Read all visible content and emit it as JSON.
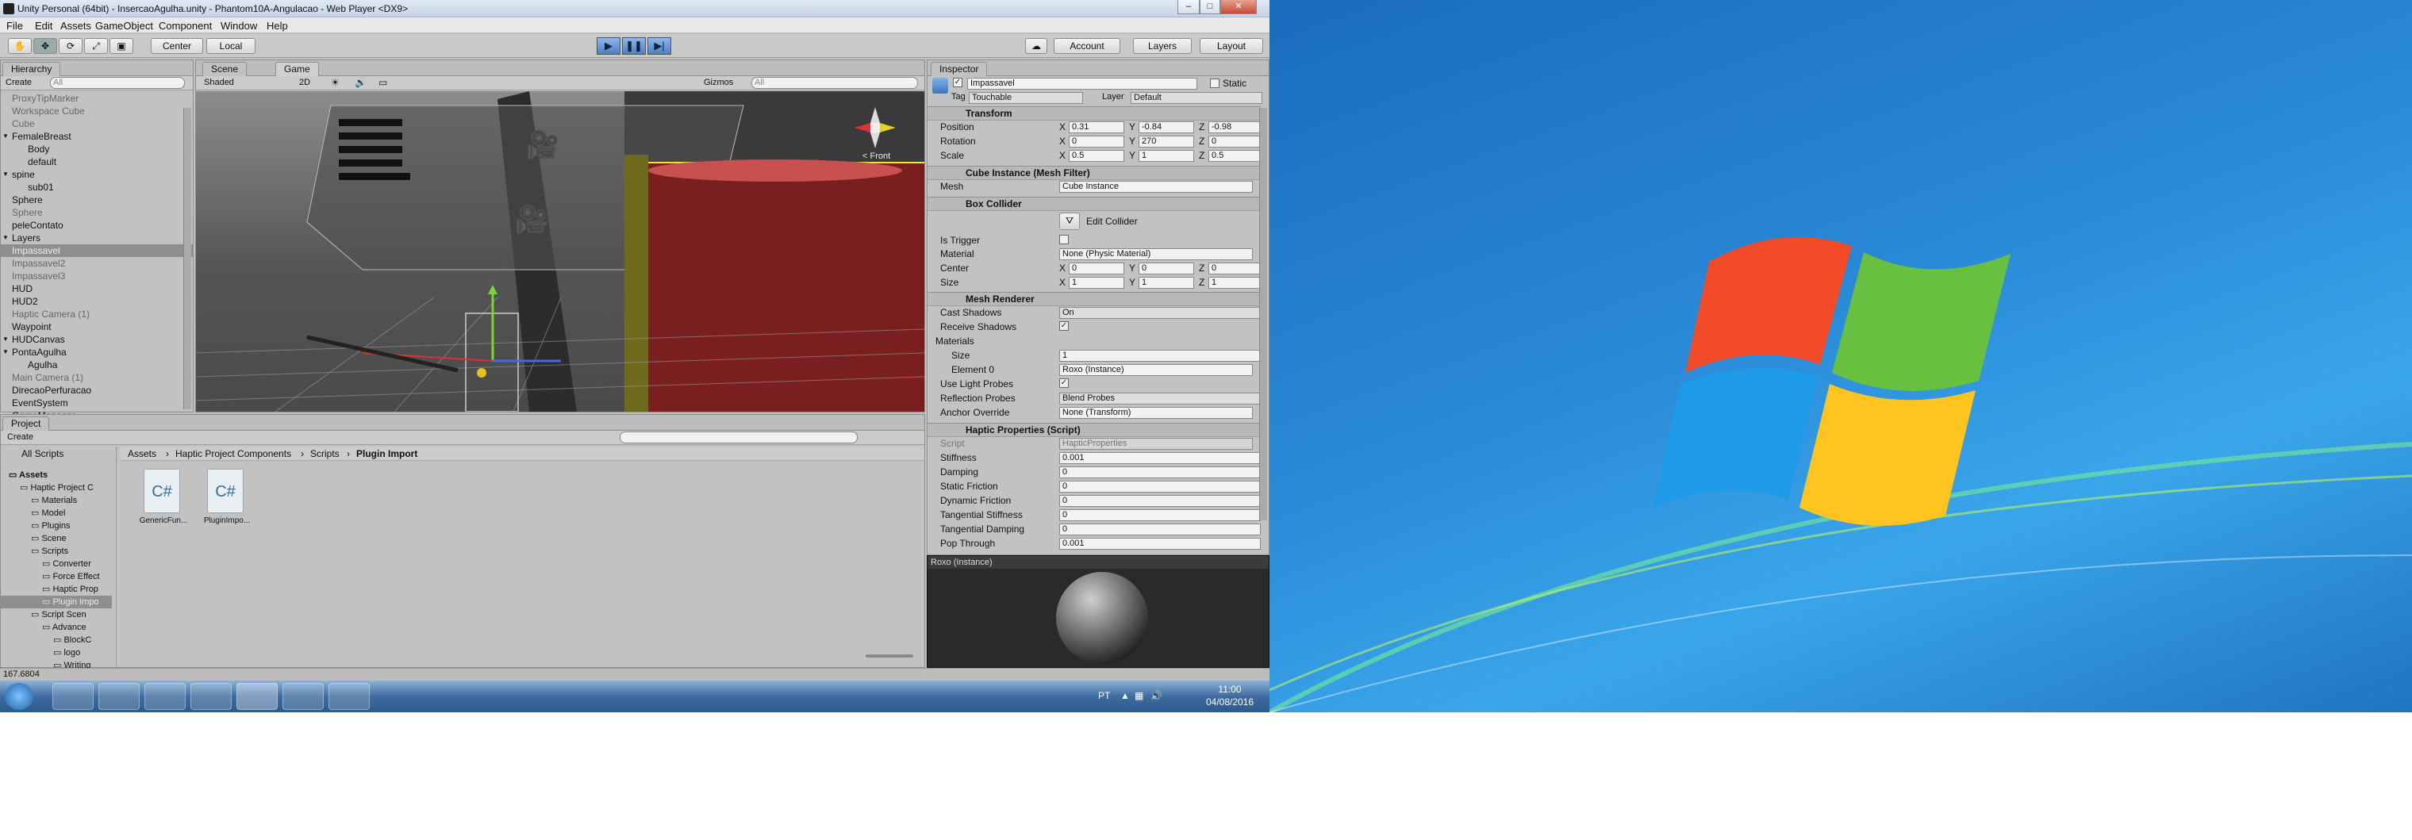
{
  "window": {
    "title": "Unity Personal (64bit) - InsercaoAgulha.unity - Phantom10A-Angulacao - Web Player <DX9>",
    "controls": [
      "–",
      "□",
      "✕"
    ]
  },
  "menu": [
    "File",
    "Edit",
    "Assets",
    "GameObject",
    "Component",
    "Window",
    "Help"
  ],
  "toolbar": {
    "pivot": "Center",
    "space": "Local",
    "account": "Account",
    "layers": "Layers",
    "layout": "Layout",
    "play": "▶",
    "pause": "❚❚",
    "step": "▶|"
  },
  "hierarchy": {
    "tab": "Hierarchy",
    "create": "Create",
    "search_placeholder": "All",
    "items": [
      {
        "label": "ProxyTipMarker",
        "dim": true,
        "indent": 0
      },
      {
        "label": "Workspace Cube",
        "dim": true,
        "indent": 0
      },
      {
        "label": "Cube",
        "dim": true,
        "indent": 0
      },
      {
        "label": "FemaleBreast",
        "dim": false,
        "indent": 0,
        "arrow": true
      },
      {
        "label": "Body",
        "dim": false,
        "indent": 1
      },
      {
        "label": "default",
        "dim": false,
        "indent": 1
      },
      {
        "label": "spine",
        "dim": false,
        "indent": 0,
        "arrow": true
      },
      {
        "label": "sub01",
        "dim": false,
        "indent": 1
      },
      {
        "label": "Sphere",
        "dim": false,
        "indent": 0
      },
      {
        "label": "Sphere",
        "dim": true,
        "indent": 0
      },
      {
        "label": "peleContato",
        "dim": false,
        "indent": 0
      },
      {
        "label": "Layers",
        "dim": false,
        "indent": 0,
        "arrow": true
      },
      {
        "label": "Impassavel",
        "dim": false,
        "indent": 0,
        "selected": true
      },
      {
        "label": "Impassavel2",
        "dim": true,
        "indent": 0
      },
      {
        "label": "Impassavel3",
        "dim": true,
        "indent": 0
      },
      {
        "label": "HUD",
        "dim": false,
        "indent": 0
      },
      {
        "label": "HUD2",
        "dim": false,
        "indent": 0
      },
      {
        "label": "Haptic Camera (1)",
        "dim": true,
        "indent": 0
      },
      {
        "label": "Waypoint",
        "dim": false,
        "indent": 0
      },
      {
        "label": "HUDCanvas",
        "dim": false,
        "indent": 0,
        "arrow": true
      },
      {
        "label": "PontaAgulha",
        "dim": false,
        "indent": 0,
        "arrow": true
      },
      {
        "label": "Agulha",
        "dim": false,
        "indent": 1
      },
      {
        "label": "Main Camera (1)",
        "dim": true,
        "indent": 0
      },
      {
        "label": "DirecaoPerfuracao",
        "dim": false,
        "indent": 0
      },
      {
        "label": "EventSystem",
        "dim": false,
        "indent": 0
      },
      {
        "label": "GameManager",
        "dim": false,
        "indent": 0
      }
    ]
  },
  "scene": {
    "tab_scene": "Scene",
    "tab_game": "Game",
    "shading": "Shaded",
    "mode2d": "2D",
    "gizmos": "Gizmos",
    "search_placeholder": "All",
    "gizmo_label": "< Front"
  },
  "inspector": {
    "tab": "Inspector",
    "name": "Impassavel",
    "static": "Static",
    "tag_label": "Tag",
    "tag": "Touchable",
    "layer_label": "Layer",
    "layer": "Default",
    "transform": {
      "title": "Transform",
      "position_label": "Position",
      "position": [
        "0.31",
        "-0.84",
        "-0.98"
      ],
      "rotation_label": "Rotation",
      "rotation": [
        "0",
        "270",
        "0"
      ],
      "scale_label": "Scale",
      "scale": [
        "0.5",
        "1",
        "0.5"
      ]
    },
    "mesh_filter": {
      "title": "Cube Instance (Mesh Filter)",
      "mesh_label": "Mesh",
      "mesh": "Cube Instance"
    },
    "box_collider": {
      "title": "Box Collider",
      "edit": "Edit Collider",
      "is_trigger_label": "Is Trigger",
      "material_label": "Material",
      "material": "None (Physic Material)",
      "center_label": "Center",
      "center": [
        "0",
        "0",
        "0"
      ],
      "size_label": "Size",
      "size": [
        "1",
        "1",
        "1"
      ]
    },
    "mesh_renderer": {
      "title": "Mesh Renderer",
      "cast_shadows_label": "Cast Shadows",
      "cast_shadows": "On",
      "receive_shadows_label": "Receive Shadows",
      "materials_label": "Materials",
      "size_label": "Size",
      "size": "1",
      "element0_label": "Element 0",
      "element0": "Roxo (Instance)",
      "light_probes_label": "Use Light Probes",
      "reflection_probes_label": "Reflection Probes",
      "reflection_probes": "Blend Probes",
      "anchor_override_label": "Anchor Override",
      "anchor_override": "None (Transform)"
    },
    "haptic": {
      "title": "Haptic Properties (Script)",
      "script_label": "Script",
      "script": "HapticProperties",
      "rows": [
        {
          "label": "Stiffness",
          "value": "0.001"
        },
        {
          "label": "Damping",
          "value": "0"
        },
        {
          "label": "Static Friction",
          "value": "0"
        },
        {
          "label": "Dynamic Friction",
          "value": "0"
        },
        {
          "label": "Tangential Stiffness",
          "value": "0"
        },
        {
          "label": "Tangential Damping",
          "value": "0"
        },
        {
          "label": "Pop Through",
          "value": "0.001"
        }
      ]
    },
    "preview_title": "Roxo (Instance)"
  },
  "project": {
    "tab": "Project",
    "create": "Create",
    "favorites": "All Scripts",
    "breadcrumb": [
      "Assets",
      "Haptic Project Components",
      "Scripts",
      "Plugin Import"
    ],
    "tree": [
      {
        "label": "Assets",
        "indent": 0,
        "bold": true
      },
      {
        "label": "Haptic Project C",
        "indent": 1
      },
      {
        "label": "Materials",
        "indent": 2
      },
      {
        "label": "Model",
        "indent": 2
      },
      {
        "label": "Plugins",
        "indent": 2
      },
      {
        "label": "Scene",
        "indent": 2
      },
      {
        "label": "Scripts",
        "indent": 2
      },
      {
        "label": "Converter",
        "indent": 3
      },
      {
        "label": "Force Effect",
        "indent": 3
      },
      {
        "label": "Haptic Prop",
        "indent": 3
      },
      {
        "label": "Plugin Impo",
        "indent": 3,
        "selected": true
      },
      {
        "label": "Script Scen",
        "indent": 2
      },
      {
        "label": "Advance",
        "indent": 3
      },
      {
        "label": "BlockC",
        "indent": 4
      },
      {
        "label": "logo",
        "indent": 4
      },
      {
        "label": "Writing",
        "indent": 4
      }
    ],
    "files": [
      "GenericFun...",
      "PluginImpo..."
    ]
  },
  "status": {
    "text": "167.6804"
  },
  "taskbar": {
    "lang": "PT",
    "time": "11:00",
    "date": "04/08/2016"
  }
}
